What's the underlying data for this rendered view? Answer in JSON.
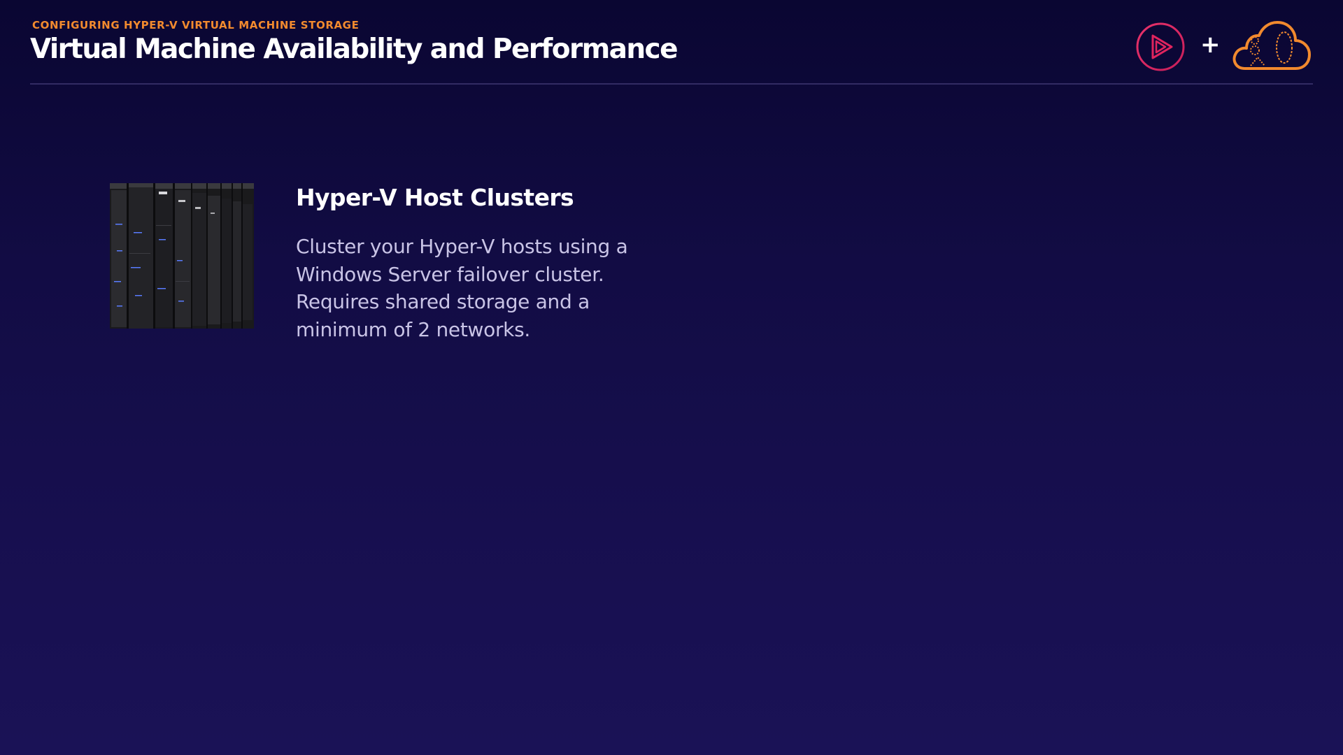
{
  "header": {
    "eyebrow": "CONFIGURING HYPER-V VIRTUAL MACHINE STORAGE",
    "title": "Virtual Machine Availability and Performance"
  },
  "logos": {
    "left_icon": "play-circle-logo-icon",
    "separator": "+",
    "right_icon": "cloud-logo-icon"
  },
  "content": {
    "image": "server-racks-image",
    "heading": "Hyper-V Host Clusters",
    "body_lines": [
      "Cluster your Hyper-V hosts using a",
      "Windows Server failover cluster.",
      "Requires shared storage and a",
      "minimum of 2 networks."
    ]
  },
  "colors": {
    "accent_orange": "#f28a2e",
    "accent_pink": "#e0245e",
    "background_top": "#0a0632",
    "background_bottom": "#1a1256",
    "body_text": "#c9c4e6"
  }
}
